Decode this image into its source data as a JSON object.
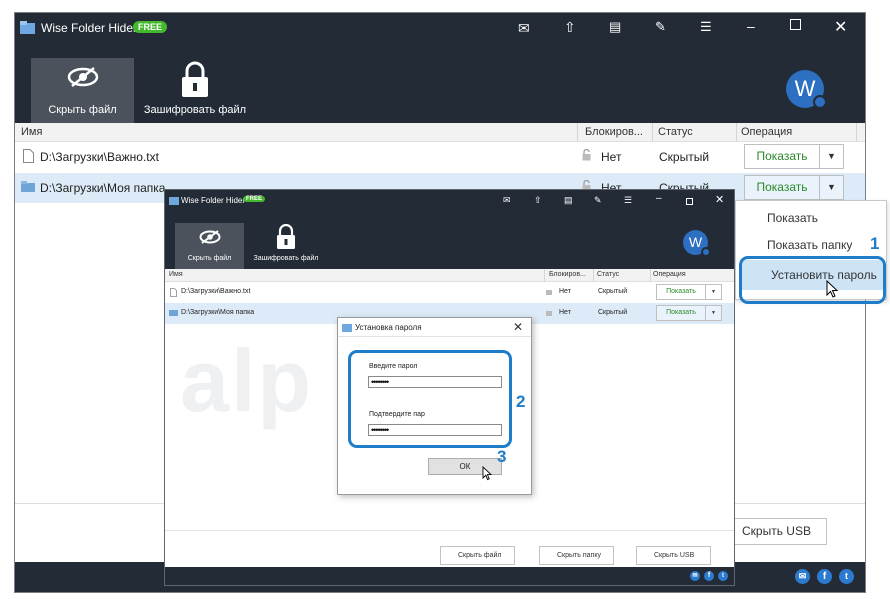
{
  "colors": {
    "titlebar": "#232b36",
    "accent": "#1e7cc8",
    "free_badge": "#44b92e",
    "show_green": "#2a8a2a"
  },
  "main": {
    "app_title": "Wise Folder Hider",
    "free_badge": "FREE",
    "toolbar": {
      "hide_file": "Скрыть файл",
      "encrypt_file": "Зашифровать файл"
    },
    "avatar": "W",
    "columns": {
      "name": "Имя",
      "lock": "Блокиров...",
      "status": "Статус",
      "operation": "Операция"
    },
    "rows": [
      {
        "name": "D:\\Загрузки\\Важно.txt",
        "lock": "Нет",
        "status": "Скрытый",
        "show": "Показать",
        "icon": "file-icon"
      },
      {
        "name": "D:\\Загрузки\\Моя папка",
        "lock": "Нет",
        "status": "Скрытый",
        "show": "Показать",
        "icon": "folder-icon"
      }
    ],
    "context_menu": [
      "Показать",
      "Показать папку",
      "Установить пароль"
    ],
    "hide_usb": "Скрыть USB"
  },
  "inner": {
    "app_title": "Wise Folder Hider",
    "free_badge": "FREE",
    "toolbar": {
      "hide_file": "Скрыть файл",
      "encrypt_file": "Зашифровать файл"
    },
    "avatar": "W",
    "columns": {
      "name": "Имя",
      "lock": "Блокиров...",
      "status": "Статус",
      "operation": "Операция"
    },
    "rows": [
      {
        "name": "D:\\Загрузки\\Важно.txt",
        "lock": "Нет",
        "status": "Скрытый",
        "show": "Показать"
      },
      {
        "name": "D:\\Загрузки\\Моя папка",
        "lock": "Нет",
        "status": "Скрытый",
        "show": "Показать"
      }
    ],
    "bottom": {
      "hide_file": "Скрыть файл",
      "hide_folder": "Скрыть папку",
      "hide_usb": "Скрыть USB"
    },
    "watermark": "alp e.ru"
  },
  "dialog": {
    "title": "Установка пароля",
    "enter_label": "Введите парол",
    "enter_value": "••••••••",
    "confirm_label": "Подтвердите пар",
    "confirm_value": "••••••••",
    "ok": "ОК"
  },
  "steps": {
    "one": "1",
    "two": "2",
    "three": "3"
  }
}
